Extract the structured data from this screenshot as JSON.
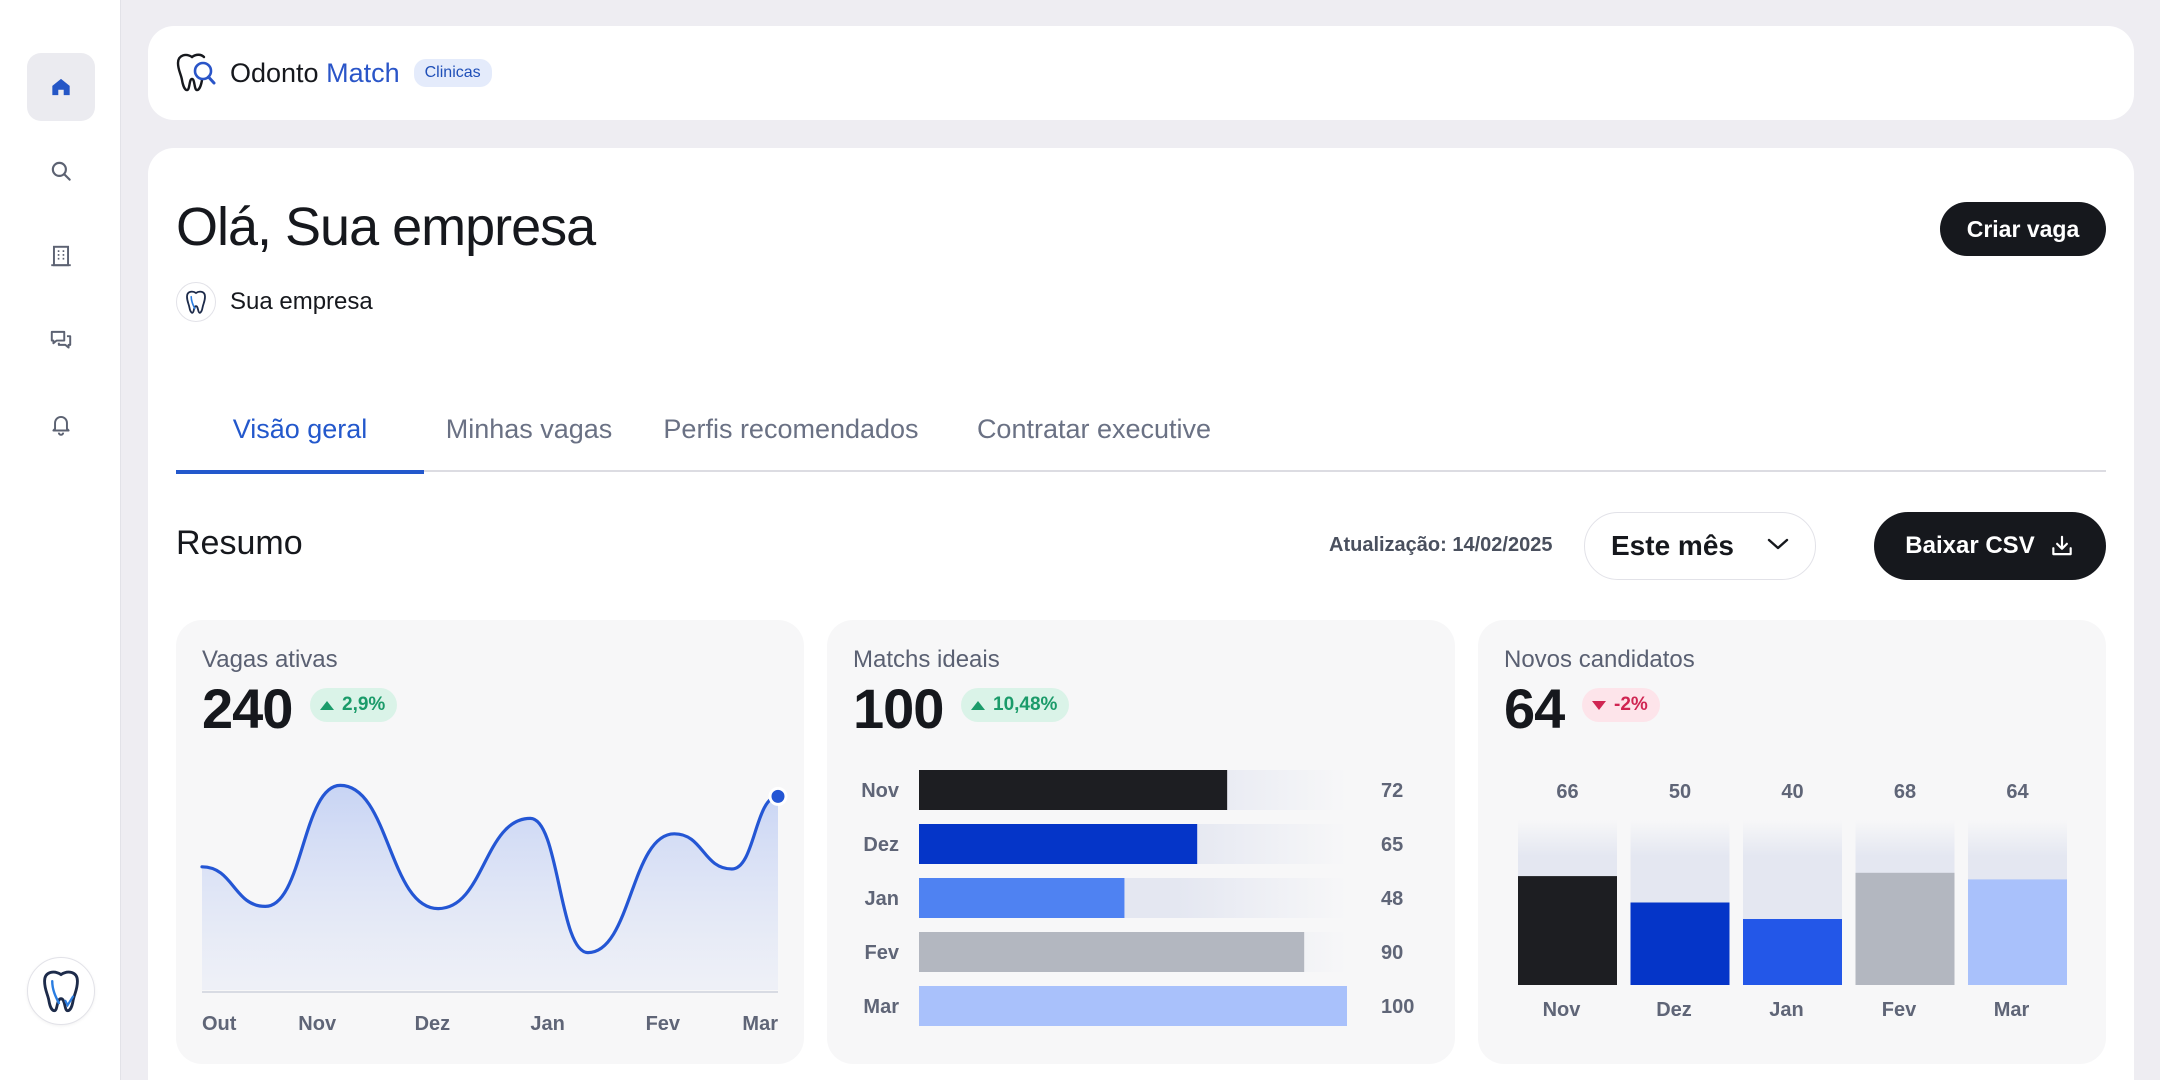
{
  "brand": {
    "name_part1": "Odonto",
    "name_part2": "Match",
    "badge": "Clinicas"
  },
  "sidebar": {
    "items": [
      {
        "icon": "home-icon",
        "active": true
      },
      {
        "icon": "search-icon",
        "active": false
      },
      {
        "icon": "building-icon",
        "active": false
      },
      {
        "icon": "chat-icon",
        "active": false
      },
      {
        "icon": "bell-icon",
        "active": false
      }
    ]
  },
  "header": {
    "greeting": "Olá, Sua empresa",
    "company_name": "Sua empresa",
    "create_button": "Criar vaga"
  },
  "tabs": [
    {
      "label": "Visão geral",
      "active": true
    },
    {
      "label": "Minhas vagas",
      "active": false
    },
    {
      "label": "Perfis recomendados",
      "active": false
    },
    {
      "label": "Contratar executive",
      "active": false
    }
  ],
  "summary": {
    "title": "Resumo",
    "updated": "Atualização: 14/02/2025",
    "period": "Este mês",
    "download_button": "Baixar CSV"
  },
  "cards": [
    {
      "title": "Vagas ativas",
      "value": "240",
      "delta": "2,9%",
      "trend": "up"
    },
    {
      "title": "Matchs ideais",
      "value": "100",
      "delta": "10,48%",
      "trend": "up"
    },
    {
      "title": "Novos candidatos",
      "value": "64",
      "delta": "-2%",
      "trend": "down"
    }
  ],
  "colors": {
    "accent": "#2358cc",
    "dark": "#16181d",
    "up": "#1b9b6a",
    "down": "#d02552"
  },
  "chart_data": [
    {
      "type": "line",
      "x": [
        "Out",
        "Nov",
        "Dez",
        "Jan",
        "Fev",
        "Mar"
      ],
      "curve_points": [
        {
          "x": 0.0,
          "y": 0.56
        },
        {
          "x": 0.11,
          "y": 0.38
        },
        {
          "x": 0.24,
          "y": 0.93
        },
        {
          "x": 0.41,
          "y": 0.37
        },
        {
          "x": 0.57,
          "y": 0.78
        },
        {
          "x": 0.67,
          "y": 0.17
        },
        {
          "x": 0.82,
          "y": 0.71
        },
        {
          "x": 0.92,
          "y": 0.55
        },
        {
          "x": 1.0,
          "y": 0.88
        }
      ],
      "ylim": [
        0,
        1
      ]
    },
    {
      "type": "bar",
      "orientation": "horizontal",
      "categories": [
        "Nov",
        "Dez",
        "Jan",
        "Fev",
        "Mar"
      ],
      "values": [
        72,
        65,
        48,
        90,
        100
      ],
      "colors": [
        "#1d1e22",
        "#0535c8",
        "#4f82f2",
        "#b3b7c0",
        "#a9c1fb"
      ],
      "xlim": [
        0,
        100
      ]
    },
    {
      "type": "bar",
      "orientation": "vertical",
      "categories": [
        "Nov",
        "Dez",
        "Jan",
        "Fev",
        "Mar"
      ],
      "labels": [
        "66",
        "50",
        "40",
        "68",
        "64"
      ],
      "values": [
        66,
        50,
        40,
        68,
        64
      ],
      "colors": [
        "#1d1e22",
        "#0535c8",
        "#2357e8",
        "#b3b7c0",
        "#a9c1fb"
      ]
    }
  ]
}
